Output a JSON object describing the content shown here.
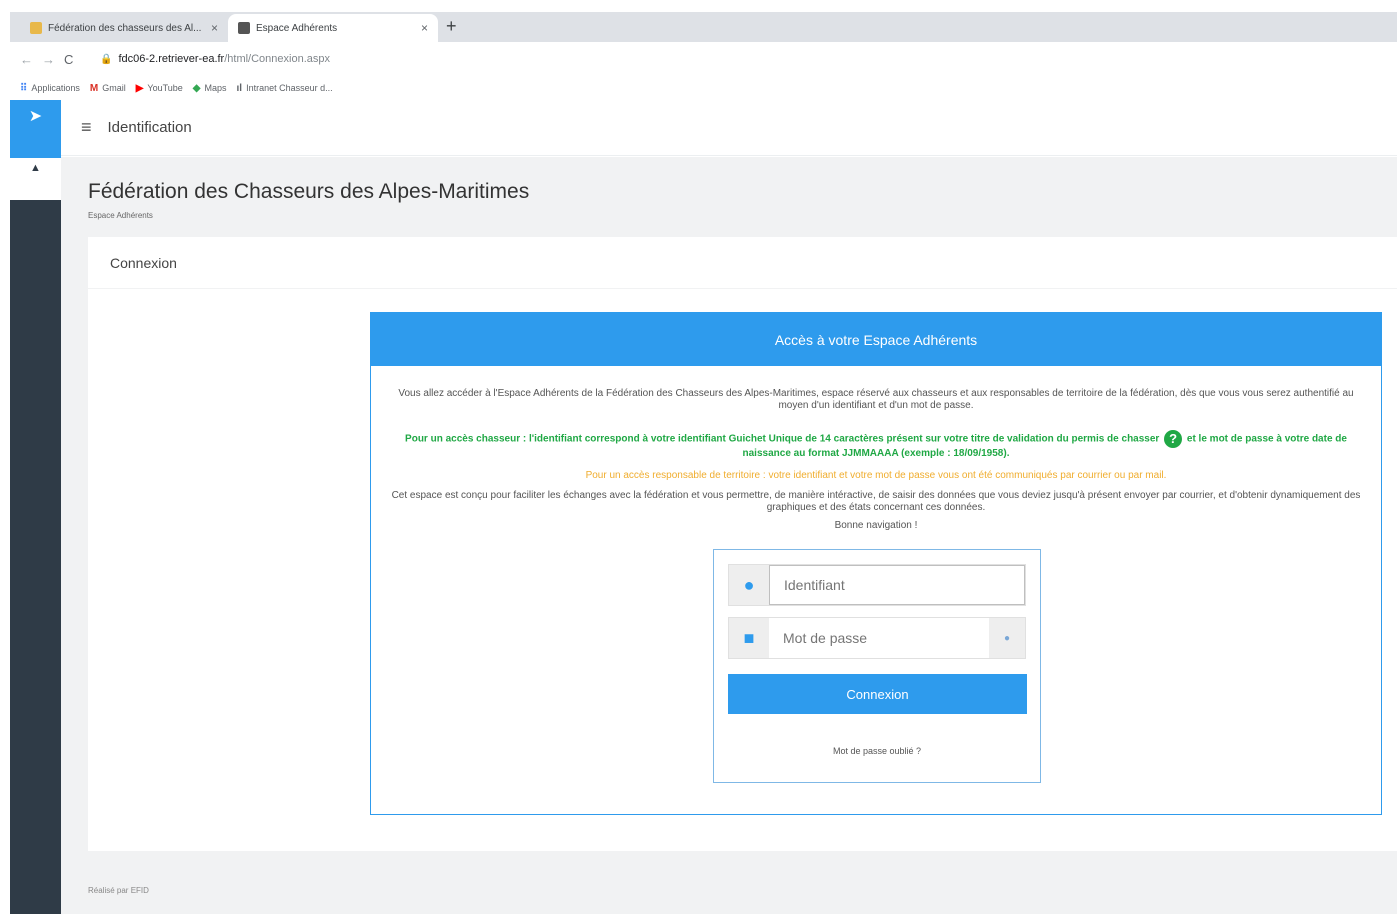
{
  "browser": {
    "tabs": [
      {
        "title": "Fédération des chasseurs des Al...",
        "active": false
      },
      {
        "title": "Espace Adhérents",
        "active": true
      }
    ],
    "new_tab": "+",
    "close": "×",
    "url_host": "fdc06-2.retriever-ea.fr",
    "url_path": "/html/Connexion.aspx",
    "bookmarks": [
      {
        "label": "Applications",
        "icon": "apps-grid-icon"
      },
      {
        "label": "Gmail",
        "icon": "gmail-icon"
      },
      {
        "label": "YouTube",
        "icon": "youtube-icon"
      },
      {
        "label": "Maps",
        "icon": "maps-icon"
      },
      {
        "label": "Intranet Chasseur d...",
        "icon": "chart-icon"
      }
    ]
  },
  "topbar": {
    "title": "Identification"
  },
  "header": {
    "title": "Fédération des Chasseurs des Alpes-Maritimes",
    "subtitle": "Espace Adhérents"
  },
  "card": {
    "title": "Connexion"
  },
  "panel": {
    "title": "Accès à votre Espace Adhérents",
    "intro": "Vous allez accéder à l'Espace Adhérents de la Fédération des Chasseurs des Alpes-Maritimes, espace réservé aux chasseurs et aux responsables de territoire de la fédération, dès que vous vous serez authentifié au moyen d'un identifiant et d'un mot de passe.",
    "hunter_a": "Pour un accès chasseur : l'identifiant correspond à votre identifiant Guichet Unique de 14 caractères présent sur votre titre de validation du permis de chasser",
    "hunter_b": "et le mot de passe à votre date de naissance au format JJMMAAAA (exemple : 18/09/1958).",
    "manager": "Pour un accès responsable de territoire : votre identifiant et votre mot de passe vous ont été communiqués par courrier ou par mail.",
    "purpose": "Cet espace est conçu pour faciliter les échanges avec la fédération et vous permettre, de manière intéractive, de saisir des données que vous deviez jusqu'à présent envoyer par courrier, et d'obtenir dynamiquement des graphiques et des états concernant ces données.",
    "greeting": "Bonne navigation !"
  },
  "login": {
    "username_placeholder": "Identifiant",
    "password_placeholder": "Mot de passe",
    "submit": "Connexion",
    "forgot": "Mot de passe oublié ?"
  },
  "footer": {
    "text": "Réalisé par EFID"
  },
  "colors": {
    "primary": "#2e9bed",
    "sidebar": "#2f3b47",
    "green": "#20a845",
    "orange": "#f0ad2e"
  }
}
